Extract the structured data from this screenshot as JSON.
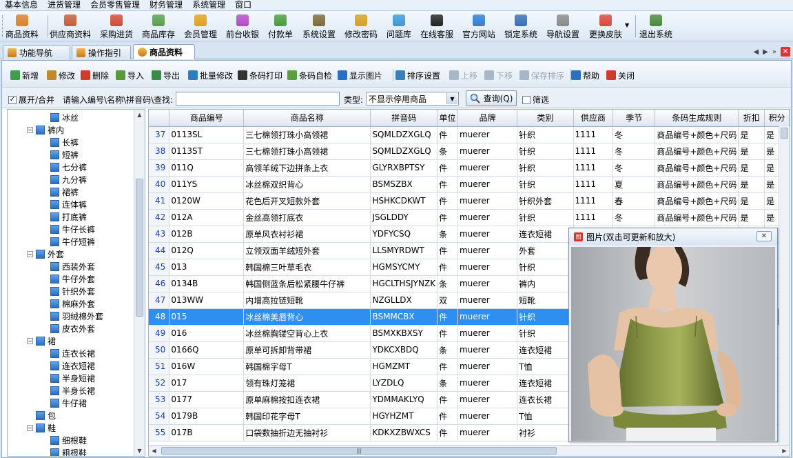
{
  "menu": [
    "基本信息",
    "进货管理",
    "会员零售管理",
    "财务管理",
    "系统管理",
    "窗口"
  ],
  "toolbar": [
    {
      "label": "商品资料",
      "icon": "products-icon",
      "color": "#d9822b"
    },
    {
      "label": "供应商资料",
      "icon": "supplier-icon",
      "color": "#c75b3a"
    },
    {
      "label": "采购进货",
      "icon": "truck-icon",
      "color": "#d24a3a"
    },
    {
      "label": "商品库存",
      "icon": "stock-icon",
      "color": "#5aa04a"
    },
    {
      "label": "会员管理",
      "icon": "member-icon",
      "color": "#e2a21c"
    },
    {
      "label": "前台收银",
      "icon": "cashier-icon",
      "color": "#b34bc8"
    },
    {
      "label": "付款单",
      "icon": "payment-icon",
      "color": "#4a9d3e"
    },
    {
      "label": "系统设置",
      "icon": "settings-icon",
      "color": "#7b6a3a"
    },
    {
      "label": "修改密码",
      "icon": "password-icon",
      "color": "#d4a21e"
    },
    {
      "label": "问题库",
      "icon": "faq-icon",
      "color": "#3c9ad6"
    },
    {
      "label": "在线客服",
      "icon": "qq-icon",
      "color": "#222222"
    },
    {
      "label": "官方网站",
      "icon": "browser-icon",
      "color": "#2f7fd6"
    },
    {
      "label": "锁定系统",
      "icon": "lock-icon",
      "color": "#3a6fb8"
    },
    {
      "label": "导航设置",
      "icon": "navigation-icon",
      "color": "#8a8a8a"
    },
    {
      "label": "更换皮肤",
      "icon": "skin-icon",
      "color": "#d8483a"
    },
    {
      "label": "退出系统",
      "icon": "exit-icon",
      "color": "#4c8a3c"
    }
  ],
  "tabs": [
    "功能导航",
    "操作指引",
    "商品资料"
  ],
  "actions": [
    {
      "label": "新增",
      "icon": "add-icon",
      "color": "#3aa04a",
      "enabled": true
    },
    {
      "label": "修改",
      "icon": "edit-icon",
      "color": "#c08a2a",
      "enabled": true
    },
    {
      "label": "删除",
      "icon": "delete-icon",
      "color": "#d23a2a",
      "enabled": true
    },
    {
      "label": "导入",
      "icon": "import-icon",
      "color": "#5a9a3a",
      "enabled": true
    },
    {
      "label": "导出",
      "icon": "export-icon",
      "color": "#3a8a4a",
      "enabled": true
    },
    {
      "label": "批量修改",
      "icon": "batch-edit-icon",
      "color": "#2a7fc0",
      "enabled": true
    },
    {
      "label": "条码打印",
      "icon": "barcode-print-icon",
      "color": "#333333",
      "enabled": true
    },
    {
      "label": "条码自检",
      "icon": "barcode-check-icon",
      "color": "#5aa03a",
      "enabled": true
    },
    {
      "label": "显示图片",
      "icon": "image-icon",
      "color": "#2a6fc0",
      "enabled": true
    },
    {
      "label": "排序设置",
      "icon": "sort-icon",
      "color": "#3a7fb8",
      "enabled": true
    },
    {
      "label": "上移",
      "icon": "move-up-icon",
      "color": "#a8b6c8",
      "enabled": false
    },
    {
      "label": "下移",
      "icon": "move-down-icon",
      "color": "#a8b6c8",
      "enabled": false
    },
    {
      "label": "保存排序",
      "icon": "save-icon",
      "color": "#a8b6c8",
      "enabled": false
    },
    {
      "label": "帮助",
      "icon": "help-icon",
      "color": "#2a6fc0",
      "enabled": true
    },
    {
      "label": "关闭",
      "icon": "close-icon",
      "color": "#d23a2a",
      "enabled": true
    }
  ],
  "search": {
    "expand_label": "展开/合并",
    "expand_checked": true,
    "prompt": "请输入编号\\名称\\拼音码\\查找:",
    "value": "",
    "type_label": "类型:",
    "type_value": "不显示停用商品",
    "query_label": "查询(Q)",
    "filter_label": "筛选",
    "filter_checked": false
  },
  "tree": [
    {
      "label": "冰丝",
      "level": 2,
      "expander": ""
    },
    {
      "label": "裤内",
      "level": 1,
      "expander": "−"
    },
    {
      "label": "长裤",
      "level": 2,
      "expander": ""
    },
    {
      "label": "短裤",
      "level": 2,
      "expander": ""
    },
    {
      "label": "七分裤",
      "level": 2,
      "expander": ""
    },
    {
      "label": "九分裤",
      "level": 2,
      "expander": ""
    },
    {
      "label": "裙裤",
      "level": 2,
      "expander": ""
    },
    {
      "label": "连体裤",
      "level": 2,
      "expander": ""
    },
    {
      "label": "打底裤",
      "level": 2,
      "expander": ""
    },
    {
      "label": "牛仔长裤",
      "level": 2,
      "expander": ""
    },
    {
      "label": "牛仔短裤",
      "level": 2,
      "expander": ""
    },
    {
      "label": "外套",
      "level": 1,
      "expander": "−"
    },
    {
      "label": "西装外套",
      "level": 2,
      "expander": ""
    },
    {
      "label": "牛仔外套",
      "level": 2,
      "expander": ""
    },
    {
      "label": "针织外套",
      "level": 2,
      "expander": ""
    },
    {
      "label": "棉麻外套",
      "level": 2,
      "expander": ""
    },
    {
      "label": "羽绒棉外套",
      "level": 2,
      "expander": ""
    },
    {
      "label": "皮衣外套",
      "level": 2,
      "expander": ""
    },
    {
      "label": "裙",
      "level": 1,
      "expander": "−"
    },
    {
      "label": "连衣长裙",
      "level": 2,
      "expander": ""
    },
    {
      "label": "连衣短裙",
      "level": 2,
      "expander": ""
    },
    {
      "label": "半身短裙",
      "level": 2,
      "expander": ""
    },
    {
      "label": "半身长裙",
      "level": 2,
      "expander": ""
    },
    {
      "label": "牛仔裙",
      "level": 2,
      "expander": ""
    },
    {
      "label": "包",
      "level": 1,
      "expander": ""
    },
    {
      "label": "鞋",
      "level": 1,
      "expander": "−"
    },
    {
      "label": "细根鞋",
      "level": 2,
      "expander": ""
    },
    {
      "label": "粗根鞋",
      "level": 2,
      "expander": ""
    }
  ],
  "grid": {
    "columns": [
      "",
      "商品编号",
      "商品名称",
      "拼音码",
      "单位",
      "品牌",
      "类别",
      "供应商",
      "季节",
      "条码生成规则",
      "折扣",
      "积分"
    ],
    "selected_row": 48,
    "rows": [
      [
        "37",
        "0113SL",
        "三七棉领打珠小高领裙",
        "SQMLDZXGLQ",
        "件",
        "muerer",
        "针织",
        "1111",
        "冬",
        "商品编号+颜色+尺码",
        "是",
        "是"
      ],
      [
        "38",
        "0113ST",
        "三七棉领打珠小高领裙",
        "SQMLDZXGLQ",
        "条",
        "muerer",
        "针织",
        "1111",
        "冬",
        "商品编号+颜色+尺码",
        "是",
        "是"
      ],
      [
        "39",
        "011Q",
        "高领羊绒下边拼条上衣",
        "GLYRXBPTSY",
        "件",
        "muerer",
        "针织",
        "1111",
        "冬",
        "商品编号+颜色+尺码",
        "是",
        "是"
      ],
      [
        "40",
        "011YS",
        "冰丝棉双织背心",
        "BSMSZBX",
        "件",
        "muerer",
        "针织",
        "1111",
        "夏",
        "商品编号+颜色+尺码",
        "是",
        "是"
      ],
      [
        "41",
        "0120W",
        "花色后开叉短款外套",
        "HSHKCDKWT",
        "件",
        "muerer",
        "针织外套",
        "1111",
        "春",
        "商品编号+颜色+尺码",
        "是",
        "是"
      ],
      [
        "42",
        "012A",
        "金丝高领打底衣",
        "JSGLDDY",
        "件",
        "muerer",
        "针织",
        "1111",
        "冬",
        "商品编号+颜色+尺码",
        "是",
        "是"
      ],
      [
        "43",
        "012B",
        "原单风衣衬衫裙",
        "YDFYCSQ",
        "条",
        "muerer",
        "连衣短裙",
        "",
        "",
        "",
        "",
        ""
      ],
      [
        "44",
        "012Q",
        "立领双面羊绒短外套",
        "LLSMYRDWT",
        "件",
        "muerer",
        "外套",
        "",
        "",
        "",
        "",
        ""
      ],
      [
        "45",
        "013",
        "韩国棉三叶草毛衣",
        "HGMSYCMY",
        "件",
        "muerer",
        "针织",
        "",
        "",
        "",
        "",
        ""
      ],
      [
        "46",
        "0134B",
        "韩国侧蓝条后松紧腰牛仔裤",
        "HGCLTHSJYNZK",
        "条",
        "muerer",
        "裤内",
        "",
        "",
        "",
        "",
        ""
      ],
      [
        "47",
        "013WW",
        "内增高拉链短靴",
        "NZGLLDX",
        "双",
        "muerer",
        "短靴",
        "",
        "",
        "",
        "",
        ""
      ],
      [
        "48",
        "015",
        "冰丝棉美唇背心",
        "BSMMCBX",
        "件",
        "muerer",
        "针织",
        "",
        "",
        "",
        "",
        ""
      ],
      [
        "49",
        "016",
        "冰丝棉胸镂空背心上衣",
        "BSMXKBXSY",
        "件",
        "muerer",
        "针织",
        "",
        "",
        "",
        "",
        ""
      ],
      [
        "50",
        "0166Q",
        "原单可拆卸背带裙",
        "YDKCXBDQ",
        "条",
        "muerer",
        "连衣短裙",
        "",
        "",
        "",
        "",
        ""
      ],
      [
        "51",
        "016W",
        "韩国棉字母T",
        "HGMZMT",
        "件",
        "muerer",
        "T恤",
        "",
        "",
        "",
        "",
        ""
      ],
      [
        "52",
        "017",
        "领有珠灯笼裙",
        "LYZDLQ",
        "条",
        "muerer",
        "连衣短裙",
        "",
        "",
        "",
        "",
        ""
      ],
      [
        "53",
        "0177",
        "原单麻棉按扣连衣裙",
        "YDMMAKLYQ",
        "件",
        "muerer",
        "连衣长裙",
        "",
        "",
        "",
        "",
        ""
      ],
      [
        "54",
        "0179B",
        "韩国印花字母T",
        "HGYHZMT",
        "件",
        "muerer",
        "T恤",
        "",
        "",
        "",
        "",
        ""
      ],
      [
        "55",
        "017B",
        "口袋数抽折边无抽衬衫",
        "KDKXZBWXCS",
        "件",
        "muerer",
        "衬衫",
        "",
        "",
        "",
        "",
        ""
      ]
    ]
  },
  "popup": {
    "title": "图片(双击可更新和放大)"
  }
}
